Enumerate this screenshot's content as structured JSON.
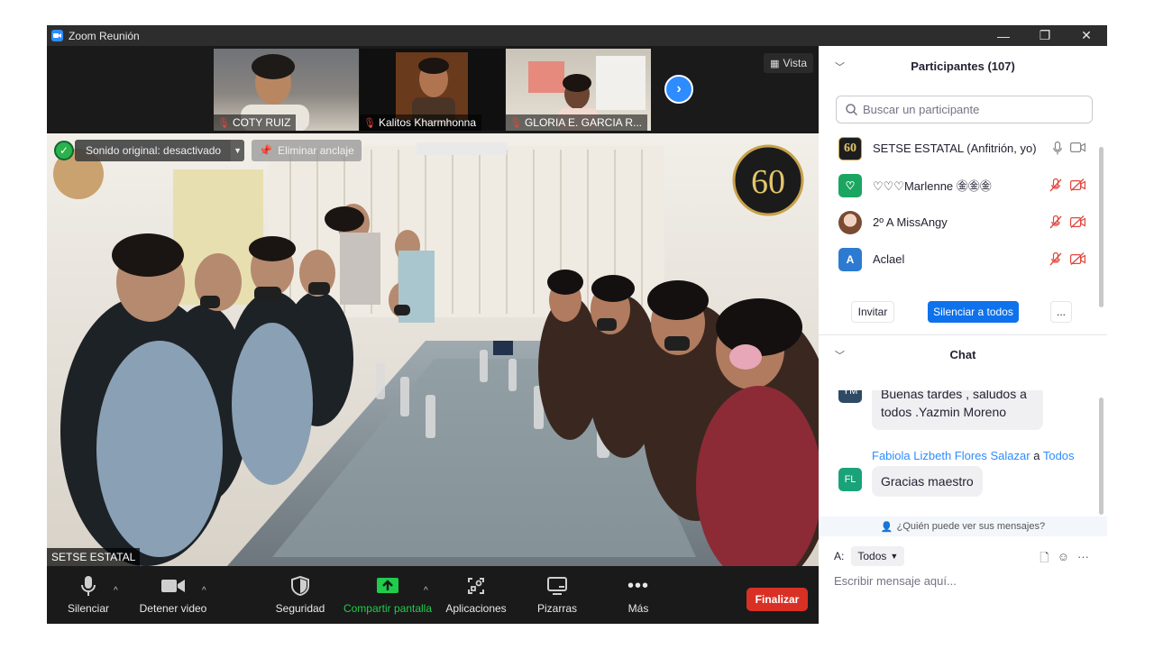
{
  "window": {
    "title": "Zoom Reunión",
    "minimize": "—",
    "restore": "❐",
    "close": "✕"
  },
  "thumbnails": [
    {
      "name": "COTY RUIZ",
      "muted": true
    },
    {
      "name": "Kalitos Kharmhonna",
      "muted": true
    },
    {
      "name": "GLORIA E. GARCIA R...",
      "muted": true
    }
  ],
  "view_button": "Vista",
  "main_video": {
    "sound_label": "Sonido original: desactivado",
    "unpin_label": "Eliminar anclaje",
    "speaker_name": "SETSE ESTATAL",
    "logo_text": "60"
  },
  "toolbar": {
    "mute": "Silenciar",
    "stop_video": "Detener video",
    "security": "Seguridad",
    "share_screen": "Compartir pantalla",
    "apps": "Aplicaciones",
    "whiteboards": "Pizarras",
    "more": "Más",
    "end": "Finalizar"
  },
  "participants": {
    "header": "Participantes (107)",
    "search_placeholder": "Buscar un participante",
    "list": [
      {
        "name": "SETSE ESTATAL (Anfitrión, yo)",
        "avatar": "60",
        "avatar_color": "#3a3a3a",
        "muted": false
      },
      {
        "name": "♡♡♡Marlenne ㊎㊎㊎",
        "avatar": "♡",
        "avatar_color": "#1aa660",
        "muted": true
      },
      {
        "name": "2º A  MissAngy",
        "avatar": "",
        "avatar_color": "#b76a4a",
        "muted": true
      },
      {
        "name": "Aclael",
        "avatar": "A",
        "avatar_color": "#2c7bd1",
        "muted": true
      }
    ],
    "invite": "Invitar",
    "mute_all": "Silenciar a todos",
    "more": "..."
  },
  "chat": {
    "header": "Chat",
    "messages": [
      {
        "initials": "YM",
        "sender": "",
        "text_line1": "Buenas tardes  , saludos a",
        "text_line2": "todos  .Yazmin Moreno"
      },
      {
        "initials": "FL",
        "sender": "Fabiola Lizbeth Flores Salazar",
        "to_word": "a",
        "to": "Todos",
        "text_line1": "Gracias maestro"
      }
    ],
    "who_can_see": "¿Quién puede ver sus mensajes?",
    "to_label": "A:",
    "to_value": "Todos",
    "input_placeholder": "Escribir mensaje aquí..."
  },
  "colors": {
    "accent": "#2d8cff",
    "share_green": "#1fcc4c",
    "end_red": "#d93025"
  }
}
